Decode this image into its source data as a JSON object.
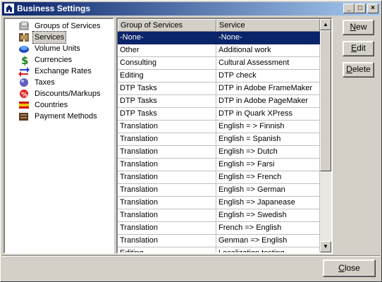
{
  "window": {
    "title": "Business Settings",
    "minimize": "_",
    "maximize": "□",
    "close": "×"
  },
  "tree": {
    "items": [
      {
        "label": "Groups of Services",
        "icon": "groups-icon"
      },
      {
        "label": "Services",
        "icon": "services-icon",
        "selected": true
      },
      {
        "label": "Volume Units",
        "icon": "volume-units-icon"
      },
      {
        "label": "Currencies",
        "icon": "currency-dollar-icon"
      },
      {
        "label": "Exchange Rates",
        "icon": "exchange-arrows-icon"
      },
      {
        "label": "Taxes",
        "icon": "taxes-icon"
      },
      {
        "label": "Discounts/Markups",
        "icon": "discount-icon"
      },
      {
        "label": "Countries",
        "icon": "country-flag-icon"
      },
      {
        "label": "Payment Methods",
        "icon": "payment-icon"
      }
    ]
  },
  "grid": {
    "columns": [
      "Group of Services",
      "Service"
    ],
    "rows": [
      [
        "-None-",
        "-None-"
      ],
      [
        "Other",
        "Additional work"
      ],
      [
        "Consulting",
        "Cultural Assessment"
      ],
      [
        "Editing",
        "DTP check"
      ],
      [
        "DTP Tasks",
        "DTP in Adobe FrameMaker"
      ],
      [
        "DTP Tasks",
        "DTP in Adobe PageMaker"
      ],
      [
        "DTP Tasks",
        "DTP in Quark XPress"
      ],
      [
        "Translation",
        "English = > Finnish"
      ],
      [
        "Translation",
        "English = Spanish"
      ],
      [
        "Translation",
        "English => Dutch"
      ],
      [
        "Translation",
        "English => Farsi"
      ],
      [
        "Translation",
        "English => French"
      ],
      [
        "Translation",
        "English => German"
      ],
      [
        "Translation",
        "English => Japanease"
      ],
      [
        "Translation",
        "English => Swedish"
      ],
      [
        "Translation",
        "French => English"
      ],
      [
        "Translation",
        "Genman => English"
      ],
      [
        "Editing",
        "Localization testing"
      ]
    ],
    "selected_row": 0
  },
  "buttons": {
    "new": {
      "label": "New",
      "mnemonic": "N"
    },
    "edit": {
      "label": "Edit",
      "mnemonic": "E"
    },
    "delete": {
      "label": "Delete",
      "mnemonic": "D"
    },
    "close": {
      "label": "Close",
      "mnemonic": "C"
    }
  }
}
